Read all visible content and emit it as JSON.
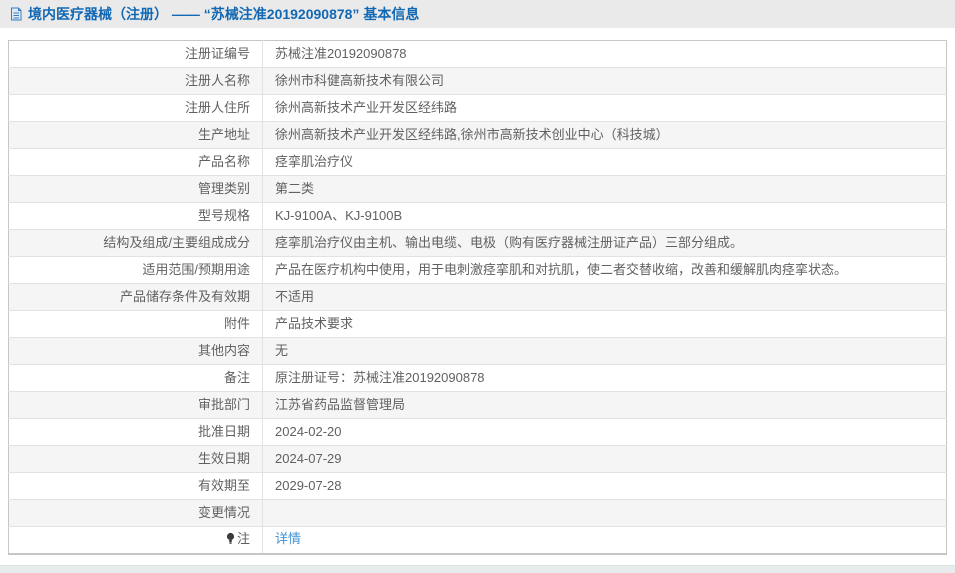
{
  "header": {
    "icon": "document-icon",
    "title": "境内医疗器械（注册） —— “苏械注准20192090878” 基本信息"
  },
  "colors": {
    "header_bg": "#eaeaea",
    "title_blue": "#1268b3",
    "stripe_gray": "#f5f5f5",
    "border_gray": "#c6c6c6",
    "text_gray": "#616161",
    "link_blue": "#4193d5"
  },
  "table": {
    "rows": [
      {
        "label": "注册证编号",
        "value": "苏械注准20192090878"
      },
      {
        "label": "注册人名称",
        "value": "徐州市科健高新技术有限公司"
      },
      {
        "label": "注册人住所",
        "value": "徐州高新技术产业开发区经纬路"
      },
      {
        "label": "生产地址",
        "value": "徐州高新技术产业开发区经纬路,徐州市高新技术创业中心（科技城）"
      },
      {
        "label": "产品名称",
        "value": "痉挛肌治疗仪"
      },
      {
        "label": "管理类别",
        "value": "第二类"
      },
      {
        "label": "型号规格",
        "value": "KJ-9100A、KJ-9100B"
      },
      {
        "label": "结构及组成/主要组成成分",
        "value": "痉挛肌治疗仪由主机、输出电缆、电极（购有医疗器械注册证产品）三部分组成。"
      },
      {
        "label": "适用范围/预期用途",
        "value": "产品在医疗机构中使用，用于电刺激痉挛肌和对抗肌，使二者交替收缩，改善和缓解肌肉痉挛状态。"
      },
      {
        "label": "产品储存条件及有效期",
        "value": "不适用"
      },
      {
        "label": "附件",
        "value": "产品技术要求"
      },
      {
        "label": "其他内容",
        "value": "无"
      },
      {
        "label": "备注",
        "value": "原注册证号：苏械注准20192090878"
      },
      {
        "label": "审批部门",
        "value": "江苏省药品监督管理局"
      },
      {
        "label": "批准日期",
        "value": "2024-02-20"
      },
      {
        "label": "生效日期",
        "value": "2024-07-29"
      },
      {
        "label": "有效期至",
        "value": "2029-07-28"
      },
      {
        "label": "变更情况",
        "value": ""
      },
      {
        "label": "注",
        "value": "详情",
        "link": true,
        "label_icon": "bulb-icon"
      }
    ]
  }
}
